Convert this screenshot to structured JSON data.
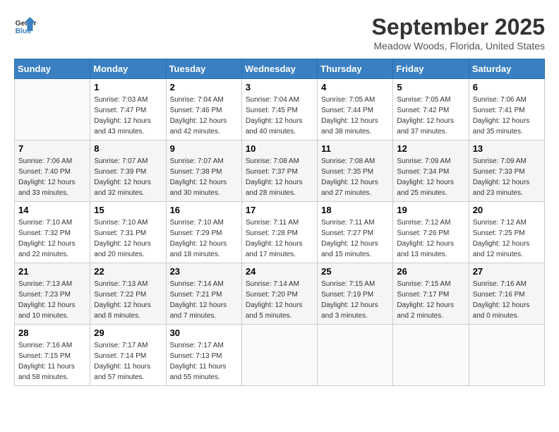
{
  "header": {
    "logo_line1": "General",
    "logo_line2": "Blue",
    "month": "September 2025",
    "location": "Meadow Woods, Florida, United States"
  },
  "days_of_week": [
    "Sunday",
    "Monday",
    "Tuesday",
    "Wednesday",
    "Thursday",
    "Friday",
    "Saturday"
  ],
  "weeks": [
    [
      {
        "day": "",
        "info": ""
      },
      {
        "day": "1",
        "info": "Sunrise: 7:03 AM\nSunset: 7:47 PM\nDaylight: 12 hours\nand 43 minutes."
      },
      {
        "day": "2",
        "info": "Sunrise: 7:04 AM\nSunset: 7:46 PM\nDaylight: 12 hours\nand 42 minutes."
      },
      {
        "day": "3",
        "info": "Sunrise: 7:04 AM\nSunset: 7:45 PM\nDaylight: 12 hours\nand 40 minutes."
      },
      {
        "day": "4",
        "info": "Sunrise: 7:05 AM\nSunset: 7:44 PM\nDaylight: 12 hours\nand 38 minutes."
      },
      {
        "day": "5",
        "info": "Sunrise: 7:05 AM\nSunset: 7:42 PM\nDaylight: 12 hours\nand 37 minutes."
      },
      {
        "day": "6",
        "info": "Sunrise: 7:06 AM\nSunset: 7:41 PM\nDaylight: 12 hours\nand 35 minutes."
      }
    ],
    [
      {
        "day": "7",
        "info": "Sunrise: 7:06 AM\nSunset: 7:40 PM\nDaylight: 12 hours\nand 33 minutes."
      },
      {
        "day": "8",
        "info": "Sunrise: 7:07 AM\nSunset: 7:39 PM\nDaylight: 12 hours\nand 32 minutes."
      },
      {
        "day": "9",
        "info": "Sunrise: 7:07 AM\nSunset: 7:38 PM\nDaylight: 12 hours\nand 30 minutes."
      },
      {
        "day": "10",
        "info": "Sunrise: 7:08 AM\nSunset: 7:37 PM\nDaylight: 12 hours\nand 28 minutes."
      },
      {
        "day": "11",
        "info": "Sunrise: 7:08 AM\nSunset: 7:35 PM\nDaylight: 12 hours\nand 27 minutes."
      },
      {
        "day": "12",
        "info": "Sunrise: 7:09 AM\nSunset: 7:34 PM\nDaylight: 12 hours\nand 25 minutes."
      },
      {
        "day": "13",
        "info": "Sunrise: 7:09 AM\nSunset: 7:33 PM\nDaylight: 12 hours\nand 23 minutes."
      }
    ],
    [
      {
        "day": "14",
        "info": "Sunrise: 7:10 AM\nSunset: 7:32 PM\nDaylight: 12 hours\nand 22 minutes."
      },
      {
        "day": "15",
        "info": "Sunrise: 7:10 AM\nSunset: 7:31 PM\nDaylight: 12 hours\nand 20 minutes."
      },
      {
        "day": "16",
        "info": "Sunrise: 7:10 AM\nSunset: 7:29 PM\nDaylight: 12 hours\nand 18 minutes."
      },
      {
        "day": "17",
        "info": "Sunrise: 7:11 AM\nSunset: 7:28 PM\nDaylight: 12 hours\nand 17 minutes."
      },
      {
        "day": "18",
        "info": "Sunrise: 7:11 AM\nSunset: 7:27 PM\nDaylight: 12 hours\nand 15 minutes."
      },
      {
        "day": "19",
        "info": "Sunrise: 7:12 AM\nSunset: 7:26 PM\nDaylight: 12 hours\nand 13 minutes."
      },
      {
        "day": "20",
        "info": "Sunrise: 7:12 AM\nSunset: 7:25 PM\nDaylight: 12 hours\nand 12 minutes."
      }
    ],
    [
      {
        "day": "21",
        "info": "Sunrise: 7:13 AM\nSunset: 7:23 PM\nDaylight: 12 hours\nand 10 minutes."
      },
      {
        "day": "22",
        "info": "Sunrise: 7:13 AM\nSunset: 7:22 PM\nDaylight: 12 hours\nand 8 minutes."
      },
      {
        "day": "23",
        "info": "Sunrise: 7:14 AM\nSunset: 7:21 PM\nDaylight: 12 hours\nand 7 minutes."
      },
      {
        "day": "24",
        "info": "Sunrise: 7:14 AM\nSunset: 7:20 PM\nDaylight: 12 hours\nand 5 minutes."
      },
      {
        "day": "25",
        "info": "Sunrise: 7:15 AM\nSunset: 7:19 PM\nDaylight: 12 hours\nand 3 minutes."
      },
      {
        "day": "26",
        "info": "Sunrise: 7:15 AM\nSunset: 7:17 PM\nDaylight: 12 hours\nand 2 minutes."
      },
      {
        "day": "27",
        "info": "Sunrise: 7:16 AM\nSunset: 7:16 PM\nDaylight: 12 hours\nand 0 minutes."
      }
    ],
    [
      {
        "day": "28",
        "info": "Sunrise: 7:16 AM\nSunset: 7:15 PM\nDaylight: 11 hours\nand 58 minutes."
      },
      {
        "day": "29",
        "info": "Sunrise: 7:17 AM\nSunset: 7:14 PM\nDaylight: 11 hours\nand 57 minutes."
      },
      {
        "day": "30",
        "info": "Sunrise: 7:17 AM\nSunset: 7:13 PM\nDaylight: 11 hours\nand 55 minutes."
      },
      {
        "day": "",
        "info": ""
      },
      {
        "day": "",
        "info": ""
      },
      {
        "day": "",
        "info": ""
      },
      {
        "day": "",
        "info": ""
      }
    ]
  ]
}
